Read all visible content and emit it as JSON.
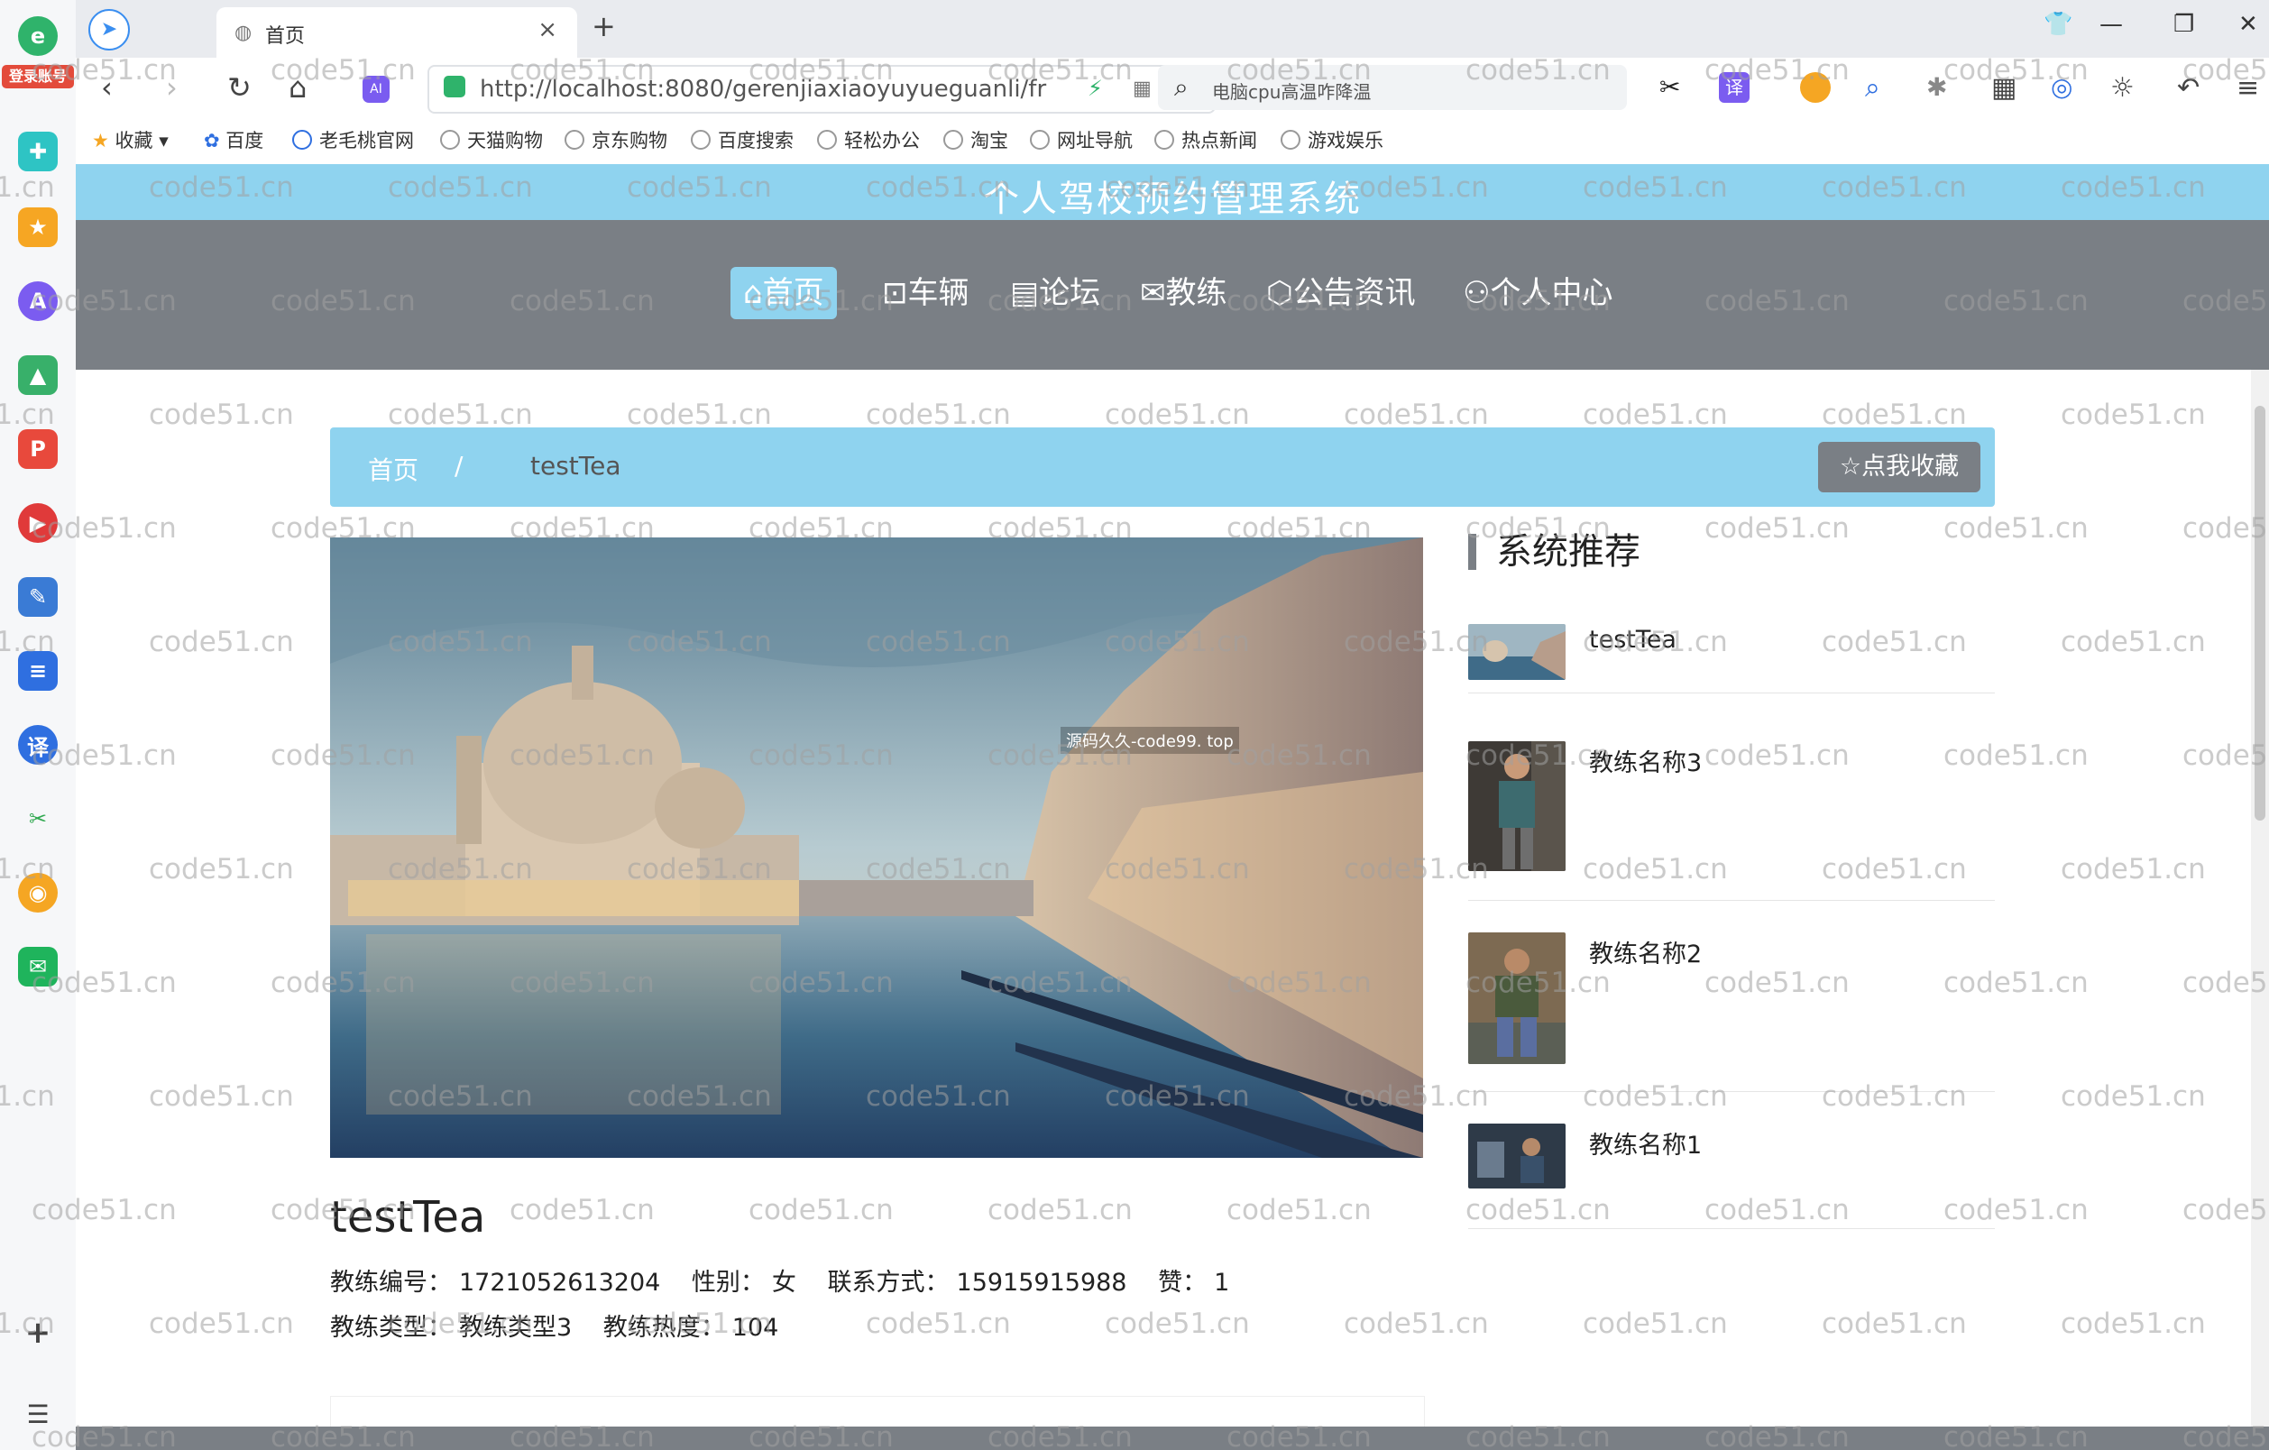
{
  "browser": {
    "tab_title": "首页",
    "url": "http://localhost:8080/gerenjiaxiaoyuyueguanli/fr",
    "search_placeholder": "电脑cpu高温咋降温",
    "login_badge": "登录账号"
  },
  "bookmarks": [
    "收藏",
    "百度",
    "老毛桃官网",
    "天猫购物",
    "京东购物",
    "百度搜索",
    "轻松办公",
    "淘宝",
    "网址导航",
    "热点新闻",
    "游戏娱乐"
  ],
  "site": {
    "title": "个人驾校预约管理系统",
    "nav": [
      "首页",
      "车辆",
      "论坛",
      "教练",
      "公告资讯",
      "个人中心"
    ],
    "nav_icons": [
      "home-icon",
      "car-icon",
      "forum-icon",
      "mail-icon",
      "box-icon",
      "user-icon"
    ]
  },
  "breadcrumb": {
    "home": "首页",
    "separator": "/",
    "current": "testTea",
    "favorite_button": "点我收藏"
  },
  "hero_watermark": "源码久久-code99. top",
  "detail": {
    "name": "testTea",
    "fields": [
      {
        "label": "教练编号：",
        "value": "1721052613204"
      },
      {
        "label": "性别：",
        "value": "女"
      },
      {
        "label": "联系方式：",
        "value": "15915915988"
      },
      {
        "label": "赞：",
        "value": "1"
      },
      {
        "label": "教练类型：",
        "value": "教练类型3"
      },
      {
        "label": "教练热度：",
        "value": "104"
      }
    ]
  },
  "recommend": {
    "heading": "系统推荐",
    "items": [
      {
        "name": "testTea"
      },
      {
        "name": "教练名称3"
      },
      {
        "name": "教练名称2"
      },
      {
        "name": "教练名称1"
      }
    ]
  },
  "watermark_text": "code51.cn",
  "colors": {
    "accent": "#8fd3ef",
    "nav_bg": "#7a7f85"
  }
}
